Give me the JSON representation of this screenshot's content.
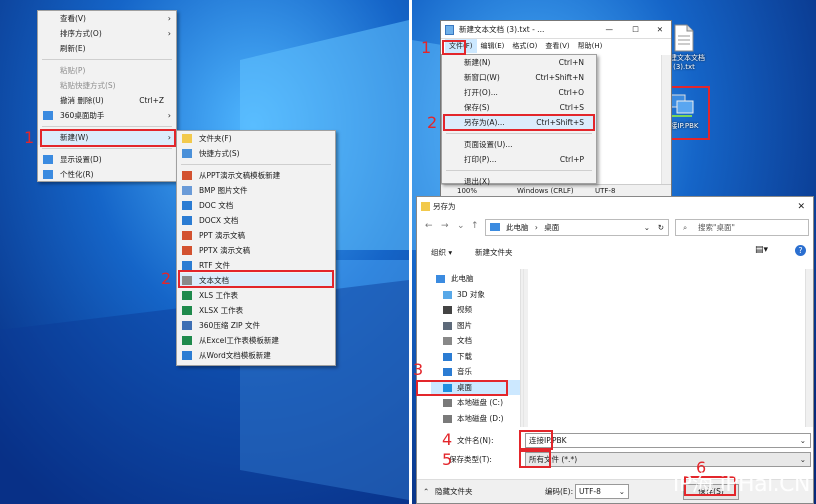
{
  "left": {
    "context_menu": {
      "items": [
        {
          "label": "查看(V)",
          "arrow": true,
          "disabled": false,
          "icon": ""
        },
        {
          "label": "排序方式(O)",
          "arrow": true,
          "disabled": false,
          "icon": ""
        },
        {
          "label": "刷新(E)",
          "arrow": false,
          "disabled": false,
          "icon": ""
        },
        {
          "sep": true
        },
        {
          "label": "粘贴(P)",
          "disabled": true,
          "icon": ""
        },
        {
          "label": "粘贴快捷方式(S)",
          "disabled": true,
          "icon": ""
        },
        {
          "label": "撤消 删除(U)",
          "shortcut": "Ctrl+Z",
          "disabled": false,
          "icon": ""
        },
        {
          "label": "360桌面助手",
          "arrow": true,
          "disabled": false,
          "icon": "360-icon"
        },
        {
          "sep": true
        },
        {
          "label": "新建(W)",
          "arrow": true,
          "disabled": false,
          "icon": "",
          "highlighted": true
        },
        {
          "sep": true
        },
        {
          "label": "显示设置(D)",
          "disabled": false,
          "icon": "display-icon"
        },
        {
          "label": "个性化(R)",
          "disabled": false,
          "icon": "personalize-icon"
        }
      ]
    },
    "new_submenu": {
      "items": [
        {
          "label": "文件夹(F)",
          "icon": "folder-icon",
          "color": "#f2c94c"
        },
        {
          "label": "快捷方式(S)",
          "icon": "shortcut-icon",
          "color": "#4a90d9"
        },
        {
          "sep": true
        },
        {
          "label": "从PPT演示文稿模板新建",
          "icon": "ppt-template-icon",
          "color": "#d35230"
        },
        {
          "label": "BMP 图片文件",
          "icon": "bmp-icon",
          "color": "#6a9bd8"
        },
        {
          "label": "DOC 文档",
          "icon": "doc-icon",
          "color": "#2b7cd3"
        },
        {
          "label": "DOCX 文档",
          "icon": "docx-icon",
          "color": "#2b7cd3"
        },
        {
          "label": "PPT 演示文稿",
          "icon": "ppt-icon",
          "color": "#d35230"
        },
        {
          "label": "PPTX 演示文稿",
          "icon": "pptx-icon",
          "color": "#d35230"
        },
        {
          "label": "RTF 文件",
          "icon": "rtf-icon",
          "color": "#2b7cd3"
        },
        {
          "label": "文本文档",
          "icon": "txt-icon",
          "color": "#8a8a8a",
          "highlighted": true
        },
        {
          "label": "XLS 工作表",
          "icon": "xls-icon",
          "color": "#1f8a4c"
        },
        {
          "label": "XLSX 工作表",
          "icon": "xlsx-icon",
          "color": "#1f8a4c"
        },
        {
          "label": "360压缩 ZIP 文件",
          "icon": "zip-icon",
          "color": "#3d6fb4"
        },
        {
          "label": "从Excel工作表模板新建",
          "icon": "excel-template-icon",
          "color": "#1f8a4c"
        },
        {
          "label": "从Word文档模板新建",
          "icon": "word-template-icon",
          "color": "#2b7cd3"
        }
      ]
    },
    "step_numbers": [
      "1",
      "2"
    ]
  },
  "right": {
    "notepad": {
      "title": "新建文本文档 (3).txt - ...",
      "menubar": [
        "文件(F)",
        "编辑(E)",
        "格式(O)",
        "查看(V)",
        "帮助(H)"
      ],
      "file_menu": [
        {
          "label": "新建(N)",
          "shortcut": "Ctrl+N"
        },
        {
          "label": "新窗口(W)",
          "shortcut": "Ctrl+Shift+N"
        },
        {
          "label": "打开(O)...",
          "shortcut": "Ctrl+O"
        },
        {
          "label": "保存(S)",
          "shortcut": "Ctrl+S"
        },
        {
          "label": "另存为(A)...",
          "shortcut": "Ctrl+Shift+S",
          "highlighted": true
        },
        {
          "sep": true
        },
        {
          "label": "页面设置(U)...",
          "shortcut": ""
        },
        {
          "label": "打印(P)...",
          "shortcut": "Ctrl+P"
        },
        {
          "sep": true
        },
        {
          "label": "退出(X)",
          "shortcut": ""
        }
      ],
      "status": {
        "zoom": "100%",
        "eol": "Windows (CRLF)",
        "encoding": "UTF-8"
      }
    },
    "desktop_icons": [
      {
        "label": "新建文本文档\n(3).txt",
        "icon": "txt-file-icon"
      },
      {
        "label": "连接IP.PBK",
        "icon": "network-connection-icon"
      }
    ],
    "saveas": {
      "title": "另存为",
      "breadcrumb": [
        "此电脑",
        "桌面"
      ],
      "search_placeholder": "搜索\"桌面\"",
      "organize": "组织 ▾",
      "new_folder": "新建文件夹",
      "tree": [
        {
          "label": "此电脑",
          "icon": "pc-icon"
        },
        {
          "label": "3D 对象",
          "icon": "3d-objects-icon"
        },
        {
          "label": "视频",
          "icon": "video-icon"
        },
        {
          "label": "图片",
          "icon": "pictures-icon"
        },
        {
          "label": "文档",
          "icon": "documents-icon"
        },
        {
          "label": "下载",
          "icon": "downloads-icon"
        },
        {
          "label": "音乐",
          "icon": "music-icon"
        },
        {
          "label": "桌面",
          "icon": "desktop-icon",
          "selected": true
        },
        {
          "label": "本地磁盘 (C:)",
          "icon": "drive-icon"
        },
        {
          "label": "本地磁盘 (D:)",
          "icon": "drive-icon"
        }
      ],
      "filename_label": "文件名(N):",
      "filename_value": "连接IP.PBK",
      "savetype_label": "保存类型(T):",
      "savetype_value": "所有文件 (*.*)",
      "hide_folders": "隐藏文件夹",
      "encoding_label": "编码(E):",
      "encoding_value": "UTF-8",
      "save_button": "保存(S)"
    },
    "step_numbers": [
      "1",
      "2",
      "3",
      "4",
      "5",
      "6"
    ]
  },
  "watermark": "IP海 iPHai.CN",
  "colors": {
    "accent_red": "#e3262b",
    "wallpaper": "#0a3d8f",
    "select_blue": "#cce8ff"
  }
}
